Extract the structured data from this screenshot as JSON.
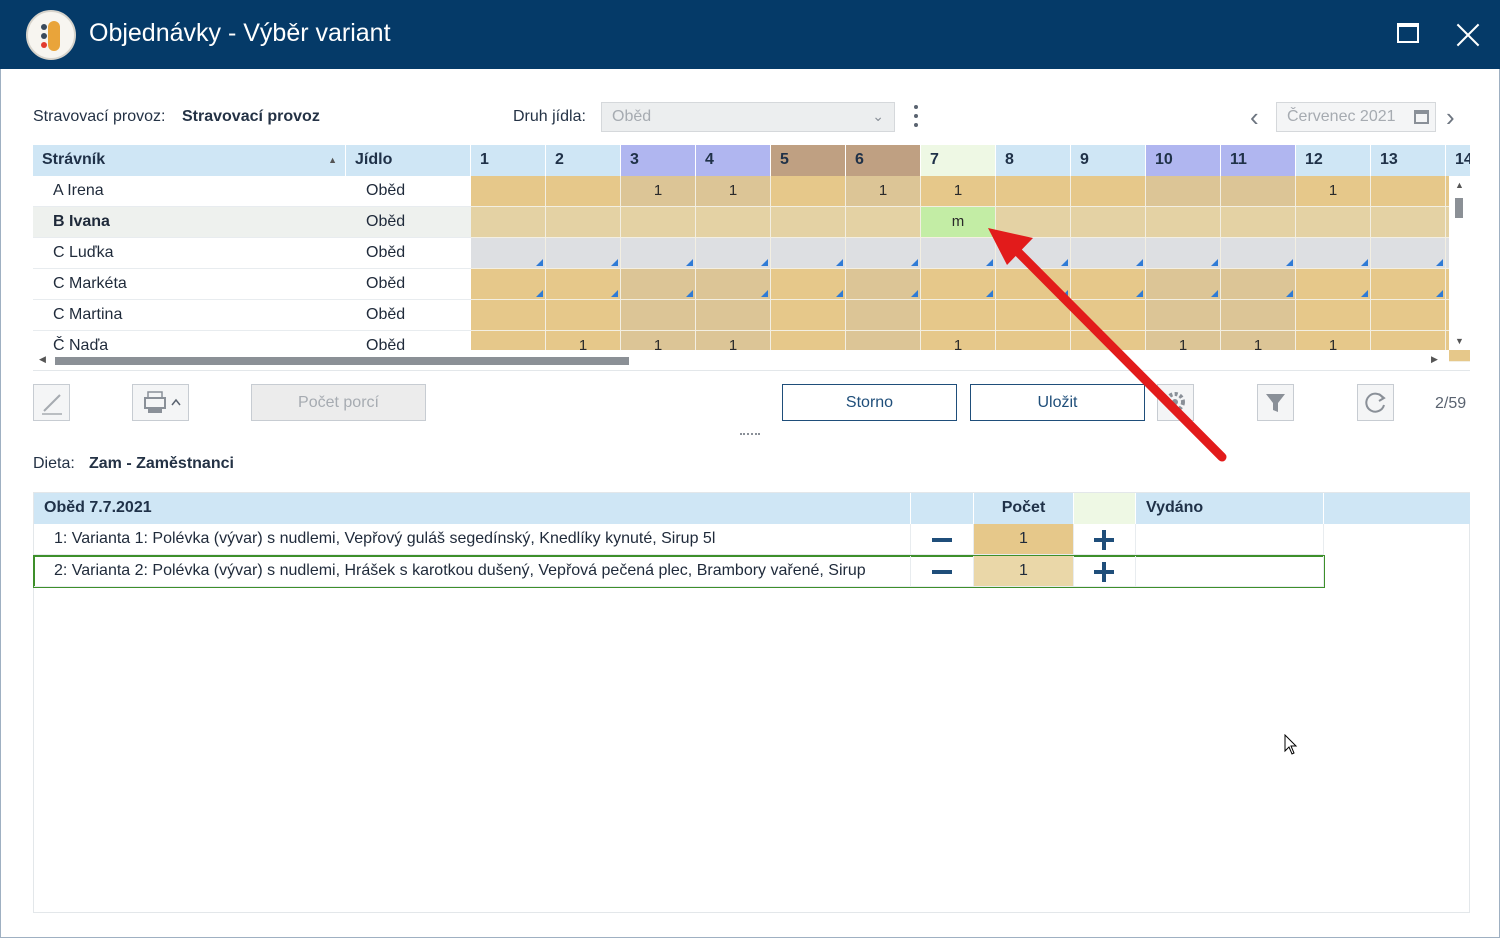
{
  "window": {
    "title": "Objednávky - Výběr variant"
  },
  "filters": {
    "provoz_label": "Stravovací provoz:",
    "provoz_value": "Stravovací provoz",
    "druh_label": "Druh jídla:",
    "druh_value": "Oběd",
    "month": "Červenec 2021"
  },
  "grid": {
    "columns": {
      "stravnik": "Strávník",
      "jidlo": "Jídlo",
      "days": [
        "1",
        "2",
        "3",
        "4",
        "5",
        "6",
        "7",
        "8",
        "9",
        "10",
        "11",
        "12",
        "13",
        "14"
      ]
    },
    "rows": [
      {
        "name": "A Irena",
        "meal": "Oběd",
        "cells": [
          "",
          "",
          "1",
          "1",
          "",
          "1",
          "1",
          "",
          "",
          "",
          "",
          "1",
          "",
          ""
        ]
      },
      {
        "name": "B Ivana",
        "meal": "Oběd",
        "cells": [
          "",
          "",
          "",
          "",
          "",
          "",
          "m",
          "",
          "",
          "",
          "",
          "",
          "",
          ""
        ]
      },
      {
        "name": "C Luďka",
        "meal": "Oběd",
        "cells": [
          "",
          "",
          "",
          "",
          "",
          "",
          "",
          "",
          "",
          "",
          "",
          "",
          "",
          ""
        ]
      },
      {
        "name": "C Markéta",
        "meal": "Oběd",
        "cells": [
          "",
          "",
          "",
          "",
          "",
          "",
          "",
          "",
          "",
          "",
          "",
          "",
          "",
          ""
        ]
      },
      {
        "name": "C Martina",
        "meal": "Oběd",
        "cells": [
          "",
          "",
          "",
          "",
          "",
          "",
          "",
          "",
          "",
          "",
          "",
          "",
          "",
          ""
        ]
      },
      {
        "name": "Č Naďa",
        "meal": "Oběd",
        "cells": [
          "",
          "1",
          "1",
          "1",
          "",
          "",
          "1",
          "",
          "",
          "1",
          "1",
          "1",
          "",
          ""
        ]
      }
    ],
    "selected_row": 1
  },
  "toolbar": {
    "pocet_porci": "Počet porcí",
    "storno": "Storno",
    "ulozit": "Uložit",
    "record_counter": "2/59"
  },
  "dieta": {
    "label": "Dieta:",
    "value": "Zam - Zaměstnanci"
  },
  "variants": {
    "header": "Oběd 7.7.2021",
    "col_pocet": "Počet",
    "col_vydano": "Vydáno",
    "items": [
      {
        "label": "1: Varianta 1: Polévka (vývar) s nudlemi, Vepřový guláš segedínský, Knedlíky kynuté, Sirup 5l",
        "count": "1",
        "issued": ""
      },
      {
        "label": "2: Varianta 2: Polévka (vývar) s nudlemi, Hrášek s karotkou dušený, Vepřová pečená plec, Brambory vařené, Sirup",
        "count": "1",
        "issued": ""
      }
    ]
  },
  "icons": [
    "app-icon",
    "maximize-icon",
    "close-icon",
    "chevron-down-icon",
    "kebab-menu-icon",
    "chevron-left-icon",
    "chevron-right-icon",
    "calendar-icon",
    "sort-up-icon",
    "edit-icon",
    "print-icon",
    "gear-icon",
    "filter-icon",
    "refresh-icon",
    "minus-icon",
    "plus-icon",
    "cursor-icon",
    "arrow-annotation"
  ],
  "colors": {
    "titlebar": "#053a68",
    "header_blue": "#cfe6f5",
    "day_purple": "#b0b6f0",
    "day_brown": "#bfa082",
    "today_green": "#eef8e4",
    "cell_gold": "#e6c88a",
    "cell_gold_alt": "#dcc596",
    "cell_gray": "#dddfe2",
    "cell_selected": "#c3eda5",
    "accent_dark": "#1f4e7a",
    "annotation_red": "#e21b1b"
  }
}
